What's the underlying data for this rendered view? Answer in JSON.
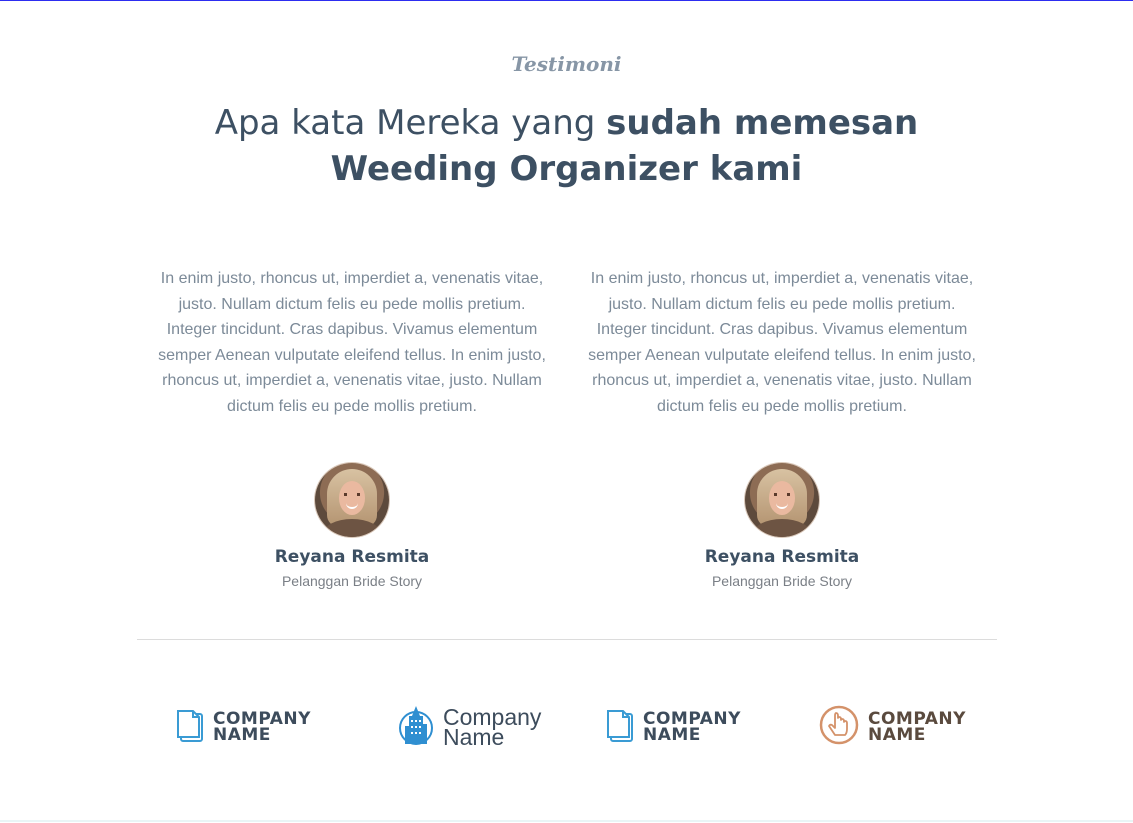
{
  "section": {
    "eyebrow": "Testimoni",
    "heading_regular": "Apa kata Mereka yang ",
    "heading_bold": "sudah memesan Weeding Organizer kami"
  },
  "testimonials": [
    {
      "quote": "In enim justo, rhoncus ut, imperdiet a, venenatis vitae, justo. Nullam dictum felis eu pede mollis pretium. Integer tincidunt. Cras dapibus. Vivamus elementum semper Aenean vulputate eleifend tellus. In enim justo, rhoncus ut, imperdiet a, venenatis vitae, justo. Nullam dictum felis eu pede mollis pretium.",
      "name": "Reyana Resmita",
      "role": "Pelanggan Bride Story"
    },
    {
      "quote": "In enim justo, rhoncus ut, imperdiet a, venenatis vitae, justo. Nullam dictum felis eu pede mollis pretium. Integer tincidunt. Cras dapibus. Vivamus elementum semper Aenean vulputate eleifend tellus. In enim justo, rhoncus ut, imperdiet a, venenatis vitae, justo. Nullam dictum felis eu pede mollis pretium.",
      "name": "Reyana Resmita",
      "role": "Pelanggan Bride Story"
    }
  ],
  "logos": [
    {
      "line1": "COMPANY",
      "line2": "NAME",
      "icon": "document-stack-icon",
      "color": "#3d4c5c",
      "accent": "#3a9bd4"
    },
    {
      "line1": "Company",
      "line2": "Name",
      "icon": "city-building-icon",
      "color": "#3d4c5c",
      "accent": "#2f8fd1"
    },
    {
      "line1": "COMPANY",
      "line2": "NAME",
      "icon": "document-stack-icon",
      "color": "#3d4c5c",
      "accent": "#3a9bd4"
    },
    {
      "line1": "COMPANY",
      "line2": "NAME",
      "icon": "pointer-hand-icon",
      "color": "#5a4a3e",
      "accent": "#d4926a"
    }
  ]
}
